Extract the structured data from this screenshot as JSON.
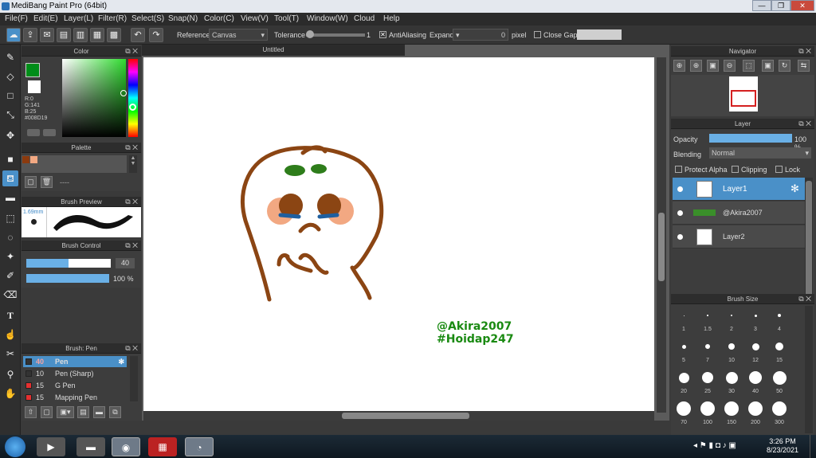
{
  "window": {
    "title": "MediBang Paint Pro (64bit)",
    "min": "—",
    "max": "❐",
    "close": "✕"
  },
  "menu": [
    "File(F)",
    "Edit(E)",
    "Layer(L)",
    "Filter(R)",
    "Select(S)",
    "Snap(N)",
    "Color(C)",
    "View(V)",
    "Tool(T)",
    "Window(W)",
    "Cloud",
    "Help"
  ],
  "toolbar": {
    "reference_label": "Reference",
    "reference_value": "Canvas",
    "tolerance_label": "Tolerance",
    "tolerance_value": "1",
    "antialias_label": "AntiAliasing",
    "expand_label": "Expand",
    "expand_value": "0",
    "pixel_label": "pixel",
    "close_gaps_label": "Close Gaps"
  },
  "color_panel": {
    "title": "Color",
    "r": "R:0",
    "g": "G:141",
    "b": "B:25",
    "hex": "#008D19",
    "primary": "#008D19",
    "secondary": "#ffffff"
  },
  "palette_panel": {
    "title": "Palette",
    "colors": [
      "#8B3A0E",
      "#f2a882"
    ],
    "dashes": "----"
  },
  "brush_preview": {
    "title": "Brush Preview",
    "size": "1.69mm"
  },
  "brush_control": {
    "title": "Brush Control",
    "size_value": "40",
    "size_fraction": 0.5,
    "opacity_value": "100 %",
    "opacity_fraction": 1.0
  },
  "brush_list": {
    "title": "Brush: Pen",
    "items": [
      {
        "size": "40",
        "name": "Pen",
        "color": "#333333",
        "selected": true
      },
      {
        "size": "10",
        "name": "Pen (Sharp)",
        "color": "#333333",
        "selected": false
      },
      {
        "size": "15",
        "name": "G Pen",
        "color": "#e53030",
        "selected": false
      },
      {
        "size": "15",
        "name": "Mapping Pen",
        "color": "#e53030",
        "selected": false
      }
    ]
  },
  "canvas": {
    "tab": "Untitled",
    "watermark_line1": "@Akira2007",
    "watermark_line2": "#Hoidap247",
    "watermark_color": "#1a8a12"
  },
  "navigator": {
    "title": "Navigator"
  },
  "layer_panel": {
    "title": "Layer",
    "opacity_label": "Opacity",
    "opacity_value": "100 %",
    "blending_label": "Blending",
    "blending_value": "Normal",
    "protect_alpha": "Protect Alpha",
    "clipping": "Clipping",
    "lock": "Lock",
    "layers": [
      {
        "name": "Layer1",
        "selected": true
      },
      {
        "name": "@Akira2007",
        "selected": false
      },
      {
        "name": "Layer2",
        "selected": false
      }
    ]
  },
  "brush_size": {
    "title": "Brush Size",
    "sizes": [
      "1",
      "1.5",
      "2",
      "3",
      "4",
      "5",
      "7",
      "10",
      "12",
      "15",
      "20",
      "25",
      "30",
      "40",
      "50",
      "70",
      "100",
      "150",
      "200",
      "300"
    ]
  },
  "taskbar": {
    "time": "3:26 PM",
    "date": "8/23/2021"
  }
}
